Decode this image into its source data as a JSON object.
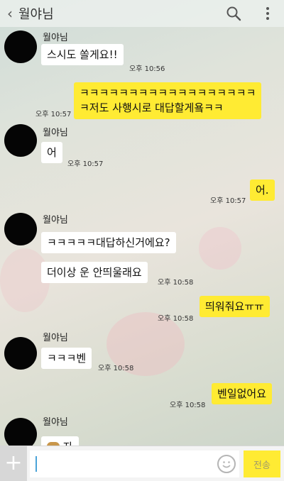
{
  "header": {
    "title": "월야님",
    "back_icon": "chevron-left-icon",
    "search_icon": "search-icon",
    "menu_icon": "more-vertical-icon"
  },
  "messages": [
    {
      "sender": "월야님",
      "text": "스시도 쏠게요!!",
      "time": "오후 10:56",
      "side": "left"
    },
    {
      "text_line1": "ㅋㅋㅋㅋㅋㅋㅋㅋㅋㅋㅋㅋㅋㅋㅋㅋㅋㅋ",
      "text_line2": "ㅋ저도 사행시로 대답할게욬ㅋㅋ",
      "time": "오후 10:57",
      "side": "right"
    },
    {
      "sender": "월야님",
      "text": "어",
      "time": "오후 10:57",
      "side": "left"
    },
    {
      "text": "어.",
      "time": "오후 10:57",
      "side": "right"
    },
    {
      "sender": "월야님",
      "text": "ㅋㅋㅋㅋㅋ대답하신거에요?",
      "side": "left"
    },
    {
      "text": "더이상 운 안띄울래요",
      "time": "오후 10:58",
      "side": "left"
    },
    {
      "text": "띄워줘요ㅠㅠ",
      "time": "오후 10:58",
      "side": "right"
    },
    {
      "sender": "월야님",
      "text": "ㅋㅋㅋ벤",
      "time": "오후 10:58",
      "side": "left"
    },
    {
      "text": "벤일없어요",
      "time": "오후 10:58",
      "side": "right"
    },
    {
      "sender": "월야님",
      "text": "자",
      "side": "left"
    }
  ],
  "input": {
    "plus_label": "+",
    "placeholder": "",
    "emoji_icon": "emoji-icon",
    "send_label": "전송"
  },
  "colors": {
    "my_bubble": "#ffeb33",
    "their_bubble": "#ffffff",
    "avatar": "#050505"
  }
}
